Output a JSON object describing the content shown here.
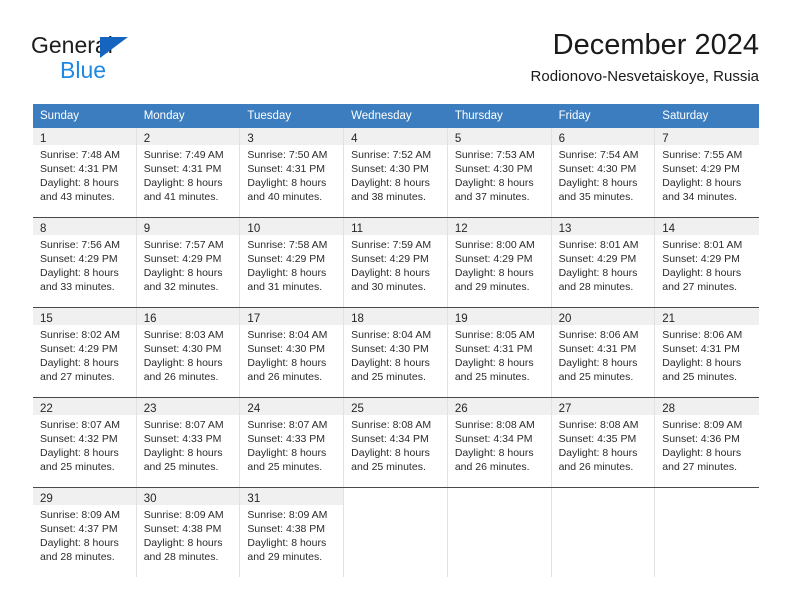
{
  "brand": {
    "name_part1": "General",
    "name_part2": "Blue",
    "triangle_color": "#1565c0",
    "blue_color": "#1e88e5"
  },
  "header": {
    "title": "December 2024",
    "subtitle": "Rodionovo-Nesvetaiskoye, Russia"
  },
  "theme": {
    "header_blue": "#3c7dbf",
    "daynum_bg": "#f0f0f0",
    "row_divider": "#4a4a4a"
  },
  "calendar": {
    "weekdays": [
      "Sunday",
      "Monday",
      "Tuesday",
      "Wednesday",
      "Thursday",
      "Friday",
      "Saturday"
    ],
    "weeks": [
      [
        {
          "day": "1",
          "sunrise": "Sunrise: 7:48 AM",
          "sunset": "Sunset: 4:31 PM",
          "daylight_line1": "Daylight: 8 hours",
          "daylight_line2": "and 43 minutes."
        },
        {
          "day": "2",
          "sunrise": "Sunrise: 7:49 AM",
          "sunset": "Sunset: 4:31 PM",
          "daylight_line1": "Daylight: 8 hours",
          "daylight_line2": "and 41 minutes."
        },
        {
          "day": "3",
          "sunrise": "Sunrise: 7:50 AM",
          "sunset": "Sunset: 4:31 PM",
          "daylight_line1": "Daylight: 8 hours",
          "daylight_line2": "and 40 minutes."
        },
        {
          "day": "4",
          "sunrise": "Sunrise: 7:52 AM",
          "sunset": "Sunset: 4:30 PM",
          "daylight_line1": "Daylight: 8 hours",
          "daylight_line2": "and 38 minutes."
        },
        {
          "day": "5",
          "sunrise": "Sunrise: 7:53 AM",
          "sunset": "Sunset: 4:30 PM",
          "daylight_line1": "Daylight: 8 hours",
          "daylight_line2": "and 37 minutes."
        },
        {
          "day": "6",
          "sunrise": "Sunrise: 7:54 AM",
          "sunset": "Sunset: 4:30 PM",
          "daylight_line1": "Daylight: 8 hours",
          "daylight_line2": "and 35 minutes."
        },
        {
          "day": "7",
          "sunrise": "Sunrise: 7:55 AM",
          "sunset": "Sunset: 4:29 PM",
          "daylight_line1": "Daylight: 8 hours",
          "daylight_line2": "and 34 minutes."
        }
      ],
      [
        {
          "day": "8",
          "sunrise": "Sunrise: 7:56 AM",
          "sunset": "Sunset: 4:29 PM",
          "daylight_line1": "Daylight: 8 hours",
          "daylight_line2": "and 33 minutes."
        },
        {
          "day": "9",
          "sunrise": "Sunrise: 7:57 AM",
          "sunset": "Sunset: 4:29 PM",
          "daylight_line1": "Daylight: 8 hours",
          "daylight_line2": "and 32 minutes."
        },
        {
          "day": "10",
          "sunrise": "Sunrise: 7:58 AM",
          "sunset": "Sunset: 4:29 PM",
          "daylight_line1": "Daylight: 8 hours",
          "daylight_line2": "and 31 minutes."
        },
        {
          "day": "11",
          "sunrise": "Sunrise: 7:59 AM",
          "sunset": "Sunset: 4:29 PM",
          "daylight_line1": "Daylight: 8 hours",
          "daylight_line2": "and 30 minutes."
        },
        {
          "day": "12",
          "sunrise": "Sunrise: 8:00 AM",
          "sunset": "Sunset: 4:29 PM",
          "daylight_line1": "Daylight: 8 hours",
          "daylight_line2": "and 29 minutes."
        },
        {
          "day": "13",
          "sunrise": "Sunrise: 8:01 AM",
          "sunset": "Sunset: 4:29 PM",
          "daylight_line1": "Daylight: 8 hours",
          "daylight_line2": "and 28 minutes."
        },
        {
          "day": "14",
          "sunrise": "Sunrise: 8:01 AM",
          "sunset": "Sunset: 4:29 PM",
          "daylight_line1": "Daylight: 8 hours",
          "daylight_line2": "and 27 minutes."
        }
      ],
      [
        {
          "day": "15",
          "sunrise": "Sunrise: 8:02 AM",
          "sunset": "Sunset: 4:29 PM",
          "daylight_line1": "Daylight: 8 hours",
          "daylight_line2": "and 27 minutes."
        },
        {
          "day": "16",
          "sunrise": "Sunrise: 8:03 AM",
          "sunset": "Sunset: 4:30 PM",
          "daylight_line1": "Daylight: 8 hours",
          "daylight_line2": "and 26 minutes."
        },
        {
          "day": "17",
          "sunrise": "Sunrise: 8:04 AM",
          "sunset": "Sunset: 4:30 PM",
          "daylight_line1": "Daylight: 8 hours",
          "daylight_line2": "and 26 minutes."
        },
        {
          "day": "18",
          "sunrise": "Sunrise: 8:04 AM",
          "sunset": "Sunset: 4:30 PM",
          "daylight_line1": "Daylight: 8 hours",
          "daylight_line2": "and 25 minutes."
        },
        {
          "day": "19",
          "sunrise": "Sunrise: 8:05 AM",
          "sunset": "Sunset: 4:31 PM",
          "daylight_line1": "Daylight: 8 hours",
          "daylight_line2": "and 25 minutes."
        },
        {
          "day": "20",
          "sunrise": "Sunrise: 8:06 AM",
          "sunset": "Sunset: 4:31 PM",
          "daylight_line1": "Daylight: 8 hours",
          "daylight_line2": "and 25 minutes."
        },
        {
          "day": "21",
          "sunrise": "Sunrise: 8:06 AM",
          "sunset": "Sunset: 4:31 PM",
          "daylight_line1": "Daylight: 8 hours",
          "daylight_line2": "and 25 minutes."
        }
      ],
      [
        {
          "day": "22",
          "sunrise": "Sunrise: 8:07 AM",
          "sunset": "Sunset: 4:32 PM",
          "daylight_line1": "Daylight: 8 hours",
          "daylight_line2": "and 25 minutes."
        },
        {
          "day": "23",
          "sunrise": "Sunrise: 8:07 AM",
          "sunset": "Sunset: 4:33 PM",
          "daylight_line1": "Daylight: 8 hours",
          "daylight_line2": "and 25 minutes."
        },
        {
          "day": "24",
          "sunrise": "Sunrise: 8:07 AM",
          "sunset": "Sunset: 4:33 PM",
          "daylight_line1": "Daylight: 8 hours",
          "daylight_line2": "and 25 minutes."
        },
        {
          "day": "25",
          "sunrise": "Sunrise: 8:08 AM",
          "sunset": "Sunset: 4:34 PM",
          "daylight_line1": "Daylight: 8 hours",
          "daylight_line2": "and 25 minutes."
        },
        {
          "day": "26",
          "sunrise": "Sunrise: 8:08 AM",
          "sunset": "Sunset: 4:34 PM",
          "daylight_line1": "Daylight: 8 hours",
          "daylight_line2": "and 26 minutes."
        },
        {
          "day": "27",
          "sunrise": "Sunrise: 8:08 AM",
          "sunset": "Sunset: 4:35 PM",
          "daylight_line1": "Daylight: 8 hours",
          "daylight_line2": "and 26 minutes."
        },
        {
          "day": "28",
          "sunrise": "Sunrise: 8:09 AM",
          "sunset": "Sunset: 4:36 PM",
          "daylight_line1": "Daylight: 8 hours",
          "daylight_line2": "and 27 minutes."
        }
      ],
      [
        {
          "day": "29",
          "sunrise": "Sunrise: 8:09 AM",
          "sunset": "Sunset: 4:37 PM",
          "daylight_line1": "Daylight: 8 hours",
          "daylight_line2": "and 28 minutes."
        },
        {
          "day": "30",
          "sunrise": "Sunrise: 8:09 AM",
          "sunset": "Sunset: 4:38 PM",
          "daylight_line1": "Daylight: 8 hours",
          "daylight_line2": "and 28 minutes."
        },
        {
          "day": "31",
          "sunrise": "Sunrise: 8:09 AM",
          "sunset": "Sunset: 4:38 PM",
          "daylight_line1": "Daylight: 8 hours",
          "daylight_line2": "and 29 minutes."
        },
        {
          "day": "",
          "sunrise": "",
          "sunset": "",
          "daylight_line1": "",
          "daylight_line2": ""
        },
        {
          "day": "",
          "sunrise": "",
          "sunset": "",
          "daylight_line1": "",
          "daylight_line2": ""
        },
        {
          "day": "",
          "sunrise": "",
          "sunset": "",
          "daylight_line1": "",
          "daylight_line2": ""
        },
        {
          "day": "",
          "sunrise": "",
          "sunset": "",
          "daylight_line1": "",
          "daylight_line2": ""
        }
      ]
    ]
  }
}
